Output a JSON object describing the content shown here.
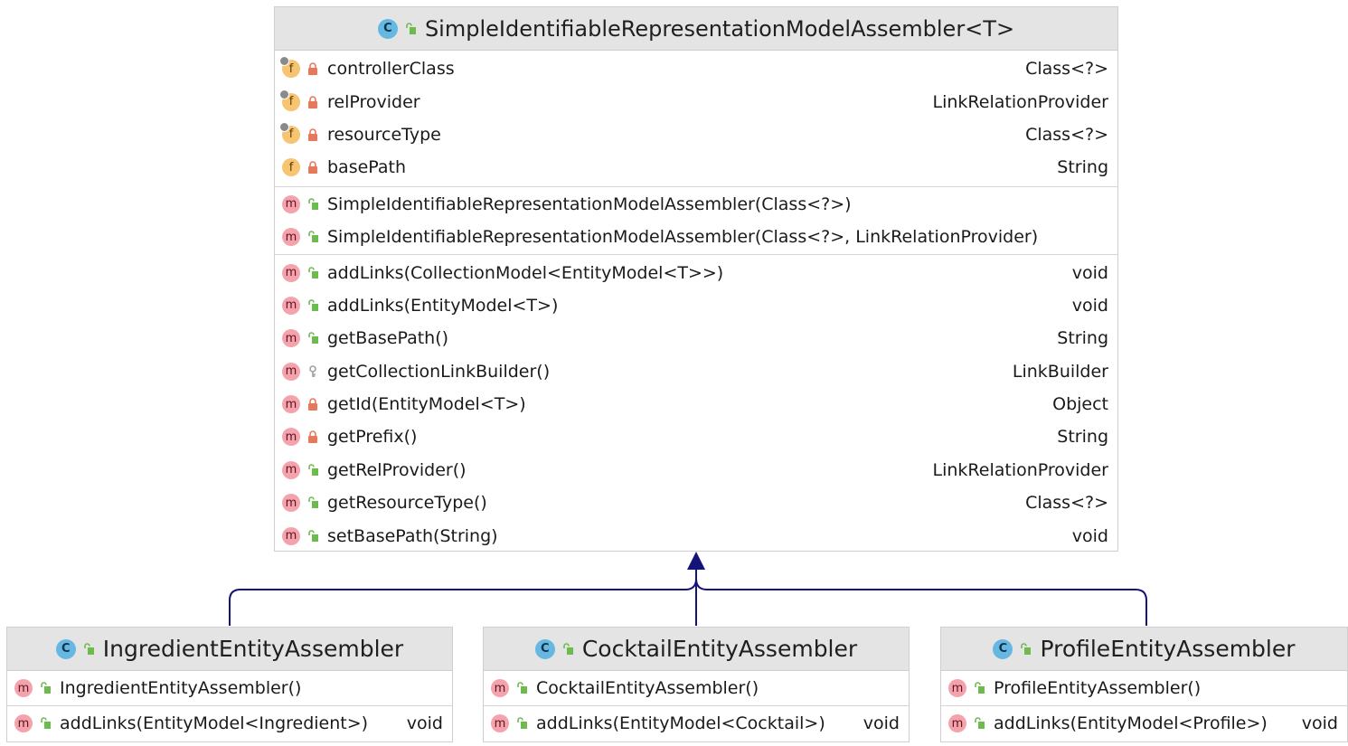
{
  "parent": {
    "kind": "class-icon",
    "name": "SimpleIdentifiableRepresentationModelAssembler<T>",
    "fields": [
      {
        "name": "controllerClass",
        "type": "Class<?>",
        "visibility": "private",
        "final": true
      },
      {
        "name": "relProvider",
        "type": "LinkRelationProvider",
        "visibility": "private",
        "final": true
      },
      {
        "name": "resourceType",
        "type": "Class<?>",
        "visibility": "private",
        "final": true
      },
      {
        "name": "basePath",
        "type": "String",
        "visibility": "private",
        "final": false
      }
    ],
    "constructors": [
      {
        "name": "SimpleIdentifiableRepresentationModelAssembler(Class<?>)",
        "visibility": "public"
      },
      {
        "name": "SimpleIdentifiableRepresentationModelAssembler(Class<?>, LinkRelationProvider)",
        "visibility": "public"
      }
    ],
    "methods": [
      {
        "name": "addLinks(CollectionModel<EntityModel<T>>)",
        "type": "void",
        "visibility": "public"
      },
      {
        "name": "addLinks(EntityModel<T>)",
        "type": "void",
        "visibility": "public"
      },
      {
        "name": "getBasePath()",
        "type": "String",
        "visibility": "public"
      },
      {
        "name": "getCollectionLinkBuilder()",
        "type": "LinkBuilder",
        "visibility": "protected"
      },
      {
        "name": "getId(EntityModel<T>)",
        "type": "Object",
        "visibility": "private"
      },
      {
        "name": "getPrefix()",
        "type": "String",
        "visibility": "private"
      },
      {
        "name": "getRelProvider()",
        "type": "LinkRelationProvider",
        "visibility": "public"
      },
      {
        "name": "getResourceType()",
        "type": "Class<?>",
        "visibility": "public"
      },
      {
        "name": "setBasePath(String)",
        "type": "void",
        "visibility": "public"
      }
    ]
  },
  "subclasses": [
    {
      "name": "IngredientEntityAssembler",
      "constructor": "IngredientEntityAssembler()",
      "method": {
        "name": "addLinks(EntityModel<Ingredient>)",
        "type": "void"
      }
    },
    {
      "name": "CocktailEntityAssembler",
      "constructor": "CocktailEntityAssembler()",
      "method": {
        "name": "addLinks(EntityModel<Cocktail>)",
        "type": "void"
      }
    },
    {
      "name": "ProfileEntityAssembler",
      "constructor": "ProfileEntityAssembler()",
      "method": {
        "name": "addLinks(EntityModel<Profile>)",
        "type": "void"
      }
    }
  ],
  "icons": {
    "class": "C",
    "field": "f",
    "method": "m"
  },
  "colors": {
    "class_icon": "#66b8e2",
    "field_icon": "#f7c472",
    "method_icon": "#f4a3ad",
    "public": "#6dba4e",
    "private": "#e8785a",
    "protected": "#a0a0a0",
    "edge": "#13137a"
  }
}
